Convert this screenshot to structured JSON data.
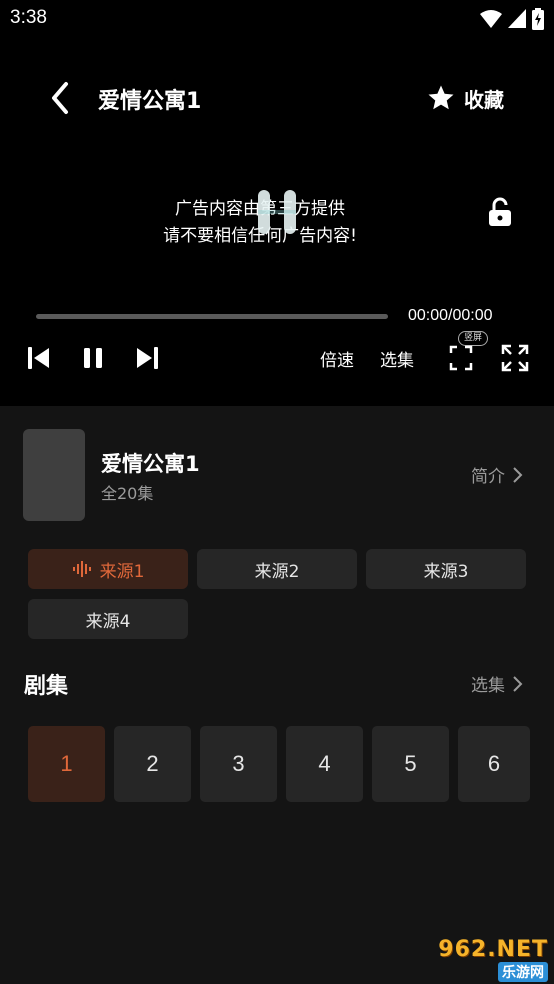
{
  "status_bar": {
    "time": "3:38"
  },
  "player": {
    "title": "爱情公寓1",
    "favorite_label": "收藏",
    "ad_line1": "广告内容由第三方提供",
    "ad_line2": "请不要相信任何广告内容!",
    "time_display": "00:00/00:00",
    "progress": 0,
    "speed_label": "倍速",
    "episodes_label": "选集",
    "portrait_label": "竖屏"
  },
  "info": {
    "title": "爱情公寓1",
    "episode_count": "全20集",
    "intro_label": "简介"
  },
  "sources": [
    {
      "label": "来源1",
      "active": true
    },
    {
      "label": "来源2",
      "active": false
    },
    {
      "label": "来源3",
      "active": false
    },
    {
      "label": "来源4",
      "active": false
    }
  ],
  "episodes_section": {
    "title": "剧集",
    "select_label": "选集",
    "items": [
      "1",
      "2",
      "3",
      "4",
      "5",
      "6"
    ],
    "active_index": 0
  },
  "watermark": {
    "main": "962.NET",
    "sub": "乐游网"
  },
  "colors": {
    "accent": "#e0683a",
    "active_bg": "#3a2219",
    "button_bg": "#262626"
  }
}
